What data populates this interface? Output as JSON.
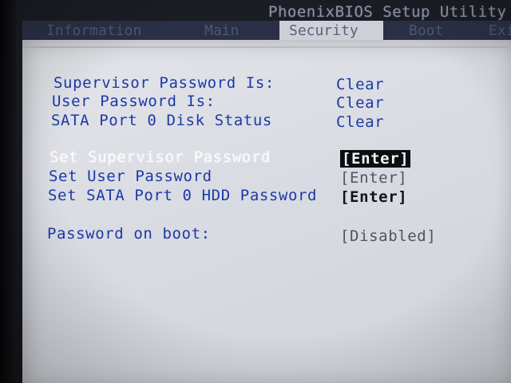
{
  "title": "PhoenixBIOS Setup Utility",
  "tabs": [
    {
      "label": "Information",
      "active": false
    },
    {
      "label": "Main",
      "active": false
    },
    {
      "label": "Security",
      "active": true
    },
    {
      "label": "Boot",
      "active": false
    },
    {
      "label": "Exit",
      "active": false
    }
  ],
  "status": [
    {
      "label": "Supervisor Password Is:",
      "value": "Clear"
    },
    {
      "label": "User Password Is:",
      "value": "Clear"
    },
    {
      "label": "SATA Port 0 Disk Status",
      "value": "Clear"
    }
  ],
  "actions": [
    {
      "label": "Set Supervisor Password",
      "value": "[Enter]",
      "selected": true
    },
    {
      "label": "Set User Password",
      "value": "[Enter]",
      "selected": false
    },
    {
      "label": "Set SATA Port 0 HDD Password",
      "value": "[Enter]",
      "selected": false
    }
  ],
  "options": [
    {
      "label": "Password on boot:",
      "value": "[Disabled]"
    }
  ],
  "colors": {
    "panel": "#dcdee4",
    "tabbar": "#2b3046",
    "label_blue": "#1c39a7",
    "selected_text": "#fbfbfd",
    "highlight_bg": "#0d0e12"
  }
}
